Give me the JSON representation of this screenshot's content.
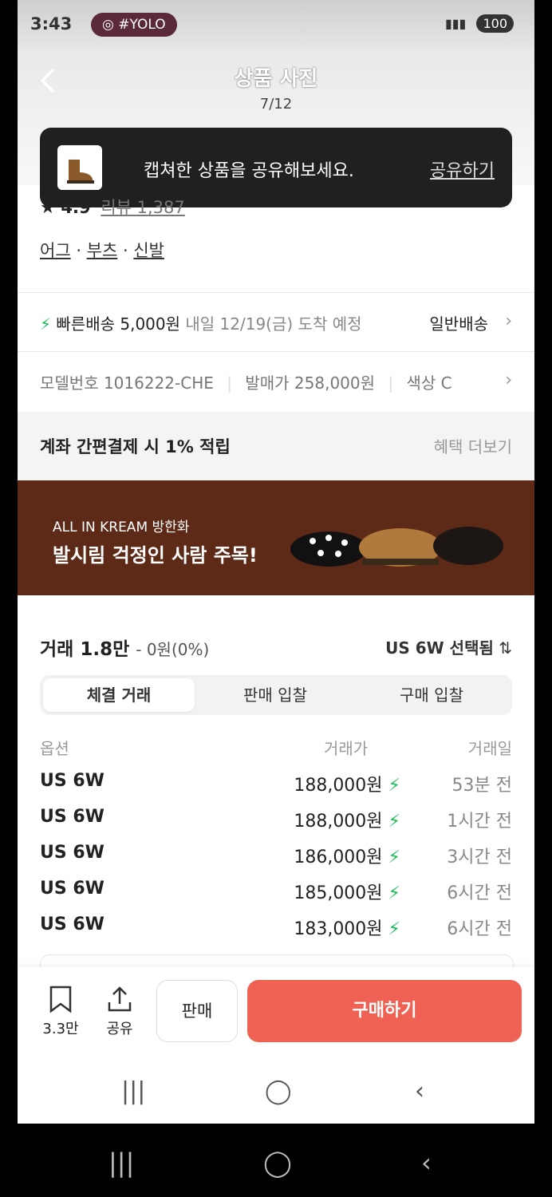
{
  "status": {
    "time": "3:43",
    "yolo": "#YOLO",
    "battery": "100"
  },
  "header": {
    "title": "상품 사진",
    "counter": "7/12"
  },
  "toast": {
    "message": "캡쳐한 상품을 공유해보세요.",
    "action": "공유하기"
  },
  "rating": {
    "score": "4.9",
    "review_label": "리뷰",
    "review_count": "1,387"
  },
  "tags": [
    "어그",
    "부츠",
    "신발"
  ],
  "shipping": {
    "label": "빠른배송 5,000원",
    "eta": "내일 12/19(금) 도착 예정",
    "alt": "일반배송"
  },
  "info": {
    "model": "모델번호 1016222-CHE",
    "release": "발매가 258,000원",
    "color": "색상 C"
  },
  "benefit": {
    "title": "계좌 간편결제 시 1% 적립",
    "more": "혜택 더보기"
  },
  "banner": {
    "sub": "ALL IN KREAM 방한화",
    "main": "발시림 걱정인 사람 주목!"
  },
  "trades": {
    "title": "거래 1.8만",
    "diff": "0원(0%)",
    "size_selected": "US 6W 선택됨",
    "tabs": [
      "체결 거래",
      "판매 입찰",
      "구매 입찰"
    ],
    "headers": {
      "option": "옵션",
      "price": "거래가",
      "date": "거래일"
    },
    "rows": [
      {
        "option": "US 6W",
        "price": "188,000원",
        "date": "53분 전"
      },
      {
        "option": "US 6W",
        "price": "188,000원",
        "date": "1시간 전"
      },
      {
        "option": "US 6W",
        "price": "186,000원",
        "date": "3시간 전"
      },
      {
        "option": "US 6W",
        "price": "185,000원",
        "date": "6시간 전"
      },
      {
        "option": "US 6W",
        "price": "183,000원",
        "date": "6시간 전"
      }
    ]
  },
  "bottom": {
    "bookmark_count": "3.3만",
    "share": "공유",
    "sell": "판매",
    "buy": "구매하기"
  },
  "colors": {
    "accent": "#ef6253",
    "bolt": "#1dbf5b",
    "banner": "#5e2a18"
  }
}
